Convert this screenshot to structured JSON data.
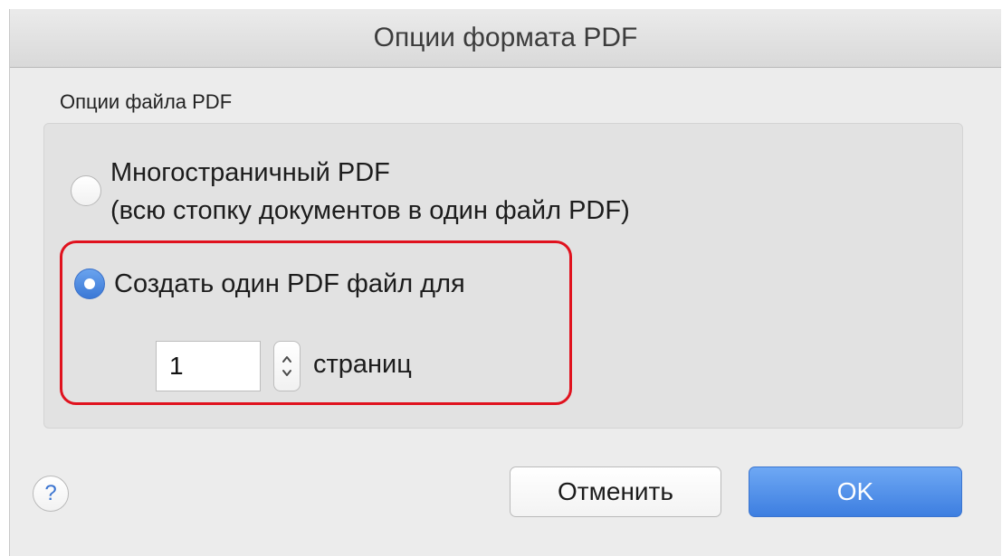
{
  "dialog": {
    "title": "Опции формата PDF"
  },
  "file_options": {
    "group_title": "Опции файла PDF",
    "multipage": {
      "label_line1": "Многостраничный PDF",
      "label_line2": "(всю стопку документов в один файл PDF)",
      "selected": false
    },
    "single_per_pages": {
      "label": "Создать один PDF файл для",
      "selected": true,
      "pages_value": "1",
      "pages_unit_label": "страниц"
    }
  },
  "buttons": {
    "help_label": "?",
    "cancel_label": "Отменить",
    "ok_label": "OK"
  },
  "colors": {
    "accent_blue": "#3d7ee0",
    "highlight_red": "#e0121e"
  },
  "icons": {
    "help": "question-mark-icon",
    "stepper": "up-down-stepper-icon"
  }
}
